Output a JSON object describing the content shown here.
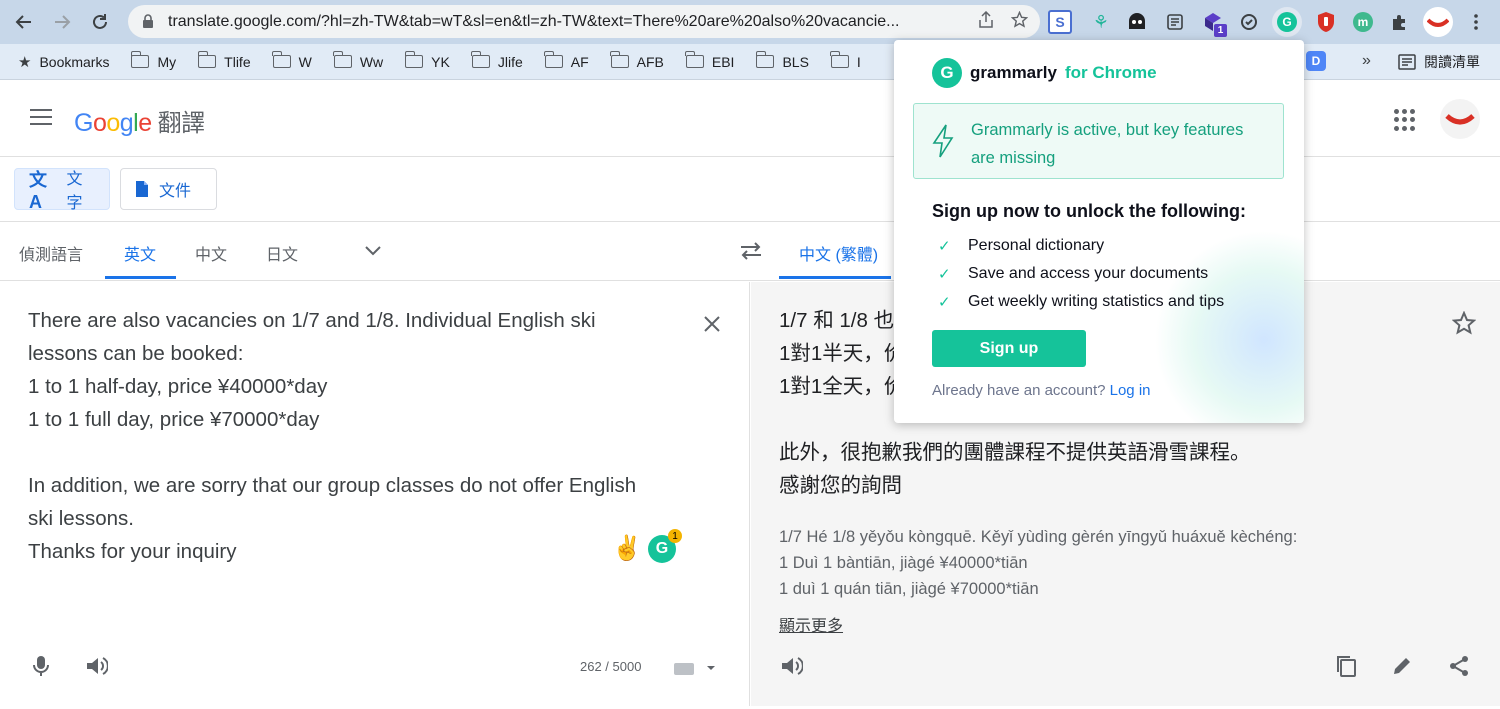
{
  "browser": {
    "url": "translate.google.com/?hl=zh-TW&tab=wT&sl=en&tl=zh-TW&text=There%20are%20also%20vacancie...",
    "bookmarks": [
      "Bookmarks",
      "My",
      "Tlife",
      "W",
      "Ww",
      "YK",
      "Jlife",
      "AF",
      "AFB",
      "EBI",
      "BLS",
      "I"
    ],
    "reading_list": "閱讀清單",
    "overflow": "»",
    "ext_badge": "1"
  },
  "header": {
    "logo_letters": [
      "G",
      "o",
      "o",
      "g",
      "l",
      "e"
    ],
    "logo_colors": [
      "#4285f4",
      "#ea4335",
      "#fbbc05",
      "#4285f4",
      "#34a853",
      "#ea4335"
    ],
    "service_name": "翻譯"
  },
  "modes": [
    {
      "label": "文字",
      "icon": "translate-icon"
    },
    {
      "label": "文件",
      "icon": "document-icon"
    }
  ],
  "source_langs": [
    "偵測語言",
    "英文",
    "中文",
    "日文"
  ],
  "target_langs": [
    "中文 (繁體)"
  ],
  "source": {
    "text": "There are also vacancies on 1/7 and 1/8. Individual English ski\nlessons can be booked:\n1 to 1 half-day, price ¥40000*day\n1 to 1 full day, price ¥70000*day\n\nIn addition, we are sorry that our group classes do not offer English\nski lessons.\nThanks for your inquiry",
    "char_count": "262 / 5000",
    "grammarly_count": "1",
    "emoji": "✌️"
  },
  "output": {
    "text": "1/7 和 1/8 也\n1對1半天，价\n1對1全天，价\n\n此外，很抱歉我們的團體課程不提供英語滑雪課程。\n感謝您的詢問",
    "transliteration": "1/7 Hé 1/8 yěyǒu kòngquē. Kěyǐ yùdìng gèrén yīngyǔ huáxuě kèchéng:\n1 Duì 1 bàntiān, jiàgé ¥40000*tiān\n1 duì 1 quán tiān, jiàgé ¥70000*tiān",
    "show_more": "顯示更多"
  },
  "grammarly": {
    "brand": "grammarly",
    "brand_suffix": "for Chrome",
    "alert": "Grammarly is active, but key features are missing",
    "heading": "Sign up now to unlock the following:",
    "features": [
      "Personal dictionary",
      "Save and access your documents",
      "Get weekly writing statistics and tips"
    ],
    "signup_label": "Sign up",
    "footer_text": "Already have an account?",
    "login_label": "Log in",
    "accent": "#15c39a"
  }
}
